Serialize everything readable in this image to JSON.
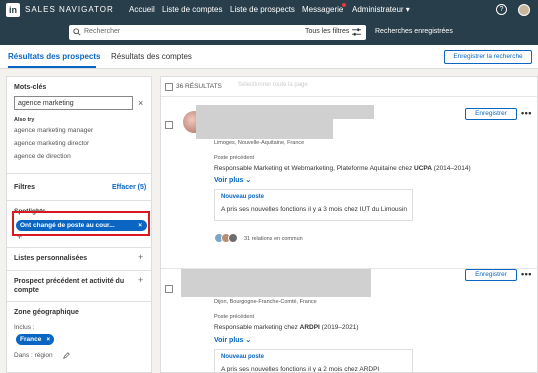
{
  "nav": {
    "logo": "in",
    "brand": "SALES NAVIGATOR",
    "links": [
      "Accueil",
      "Liste de comptes",
      "Liste de prospects",
      "Messagerie",
      "Administrateur ▾"
    ],
    "help": "?"
  },
  "search": {
    "placeholder": "Rechercher",
    "filter": "Tous les filtres",
    "saved": "Recherches enregistrées"
  },
  "tabs": {
    "prospects": "Résultats des prospects",
    "accounts": "Résultats des comptes",
    "save_search": "Enregistrer la recherche"
  },
  "left": {
    "keywords_title": "Mots-clés",
    "keyword_value": "agence marketing",
    "clear_icon": "×",
    "also_try": "Also try",
    "suggestions": [
      "agence marketing manager",
      "agence marketing director",
      "agence de direction"
    ],
    "filters_title": "Filtres",
    "filters_clear": "Effacer (5)",
    "spotlights": "Spotlights",
    "spotlight_chip": "Ont changé de poste au cour...",
    "chip_x": "×",
    "plus": "+",
    "custom_lists": "Listes personnalisées",
    "prev_prospect": "Prospect précédent et activité du",
    "prev_prospect2": "compte",
    "geo": "Zone géographique",
    "included": "Inclus :",
    "geo_chip": "France",
    "dans": "Dans : région"
  },
  "results": {
    "count": "36  RÉSULTATS",
    "select_page": "Sélectionner toute la page",
    "save": "Enregistrer",
    "more": "•••",
    "prev_label": "Poste précédent",
    "voir_plus": "Voir plus ⌄",
    "news_title": "Nouveau poste",
    "cards": [
      {
        "location": "Limoges, Nouvelle-Aquitaine, France",
        "prev_pre": "Responsable Marketing et Webmarketing, Plateforme Aquitaine chez ",
        "prev_company": "UCPA",
        "prev_dates": "  (2014–2014)",
        "news": "A pris ses nouvelles fonctions il y a 3 mois chez IUT du Limousin",
        "connections": "31 relations en commun"
      },
      {
        "location": "Dijon, Bourgogne-Franche-Comté, France",
        "prev_pre": "Responsable marketing chez ",
        "prev_company": "ARDPI",
        "prev_dates": "  (2019–2021)",
        "news": "A pris ses nouvelles fonctions il y a 2 mois chez ARDPI"
      }
    ]
  }
}
